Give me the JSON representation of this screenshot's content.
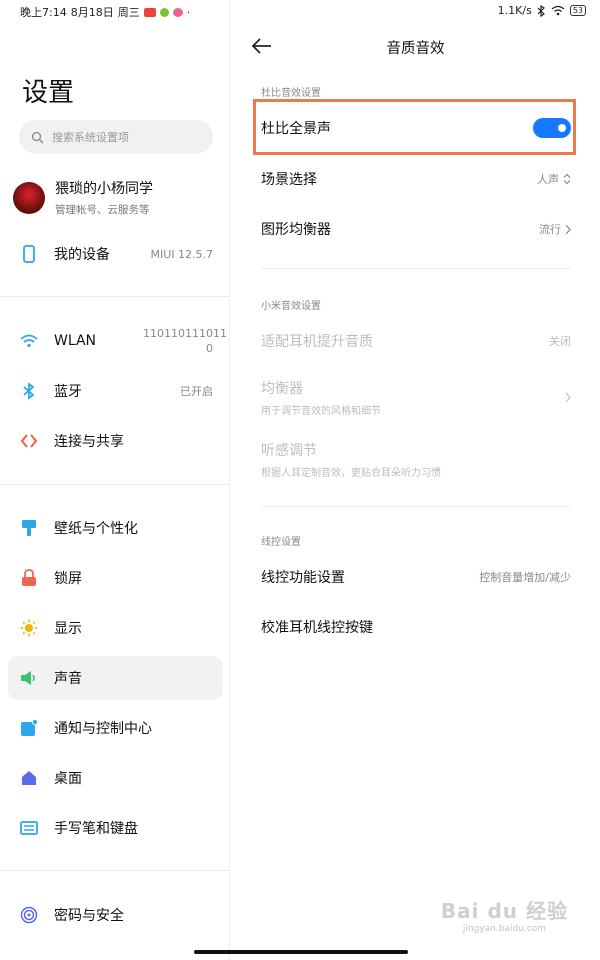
{
  "status_bar": {
    "time": "晚上7:14",
    "date": "8月18日",
    "weekday": "周三",
    "dot": "·",
    "net_speed": "1.1K/s",
    "battery": "53"
  },
  "left_pane": {
    "title": "设置",
    "search_placeholder": "搜索系统设置项",
    "profile": {
      "name": "猥琐的小杨同学",
      "sub": "管理帐号、云服务等"
    },
    "items": [
      {
        "label": "我的设备",
        "value": "MIUI 12.5.7",
        "icon": "phone-icon",
        "color": "#2aa8e8"
      },
      {
        "label": "WLAN",
        "value": "110110111011 0",
        "icon": "wifi-icon",
        "color": "#2aa8e8"
      },
      {
        "label": "蓝牙",
        "value": "已开启",
        "icon": "bluetooth-icon",
        "color": "#2aa8e8"
      },
      {
        "label": "连接与共享",
        "value": "",
        "icon": "share-icon",
        "color": "#e8643c"
      },
      {
        "label": "壁纸与个性化",
        "value": "",
        "icon": "brush-icon",
        "color": "#2aa8e8"
      },
      {
        "label": "锁屏",
        "value": "",
        "icon": "lock-icon",
        "color": "#f0654f"
      },
      {
        "label": "显示",
        "value": "",
        "icon": "sun-icon",
        "color": "#f5b400"
      },
      {
        "label": "声音",
        "value": "",
        "icon": "speaker-icon",
        "color": "#36c46f"
      },
      {
        "label": "通知与控制中心",
        "value": "",
        "icon": "notification-icon",
        "color": "#2aa8e8"
      },
      {
        "label": "桌面",
        "value": "",
        "icon": "home-icon",
        "color": "#5b6bea"
      },
      {
        "label": "手写笔和键盘",
        "value": "",
        "icon": "keyboard-icon",
        "color": "#2aa8e8"
      },
      {
        "label": "密码与安全",
        "value": "",
        "icon": "fingerprint-icon",
        "color": "#5b6bea"
      }
    ]
  },
  "right_pane": {
    "title": "音质音效",
    "dolby_section": "杜比音效设置",
    "dolby_toggle_label": "杜比全景声",
    "dolby_toggle_on": true,
    "scene_label": "场景选择",
    "scene_value": "人声",
    "eq_label": "图形均衡器",
    "eq_value": "流行",
    "mi_section": "小米音效设置",
    "adapt_label": "适配耳机提升音质",
    "adapt_value": "关闭",
    "equalizer_label": "均衡器",
    "equalizer_sub": "用于调节音效的风格和细节",
    "hearing_label": "听感调节",
    "hearing_sub": "根据人耳定制音效，更贴合耳朵听力习惯",
    "wire_section": "线控设置",
    "wire_func_label": "线控功能设置",
    "wire_func_value": "控制音量增加/减少",
    "calibrate_label": "校准耳机线控按键"
  },
  "watermark": {
    "main": "Bai du 经验",
    "sub": "jingyan.baidu.com"
  },
  "colors": {
    "accent": "#1677ff",
    "highlight": "#ec7a4a"
  }
}
